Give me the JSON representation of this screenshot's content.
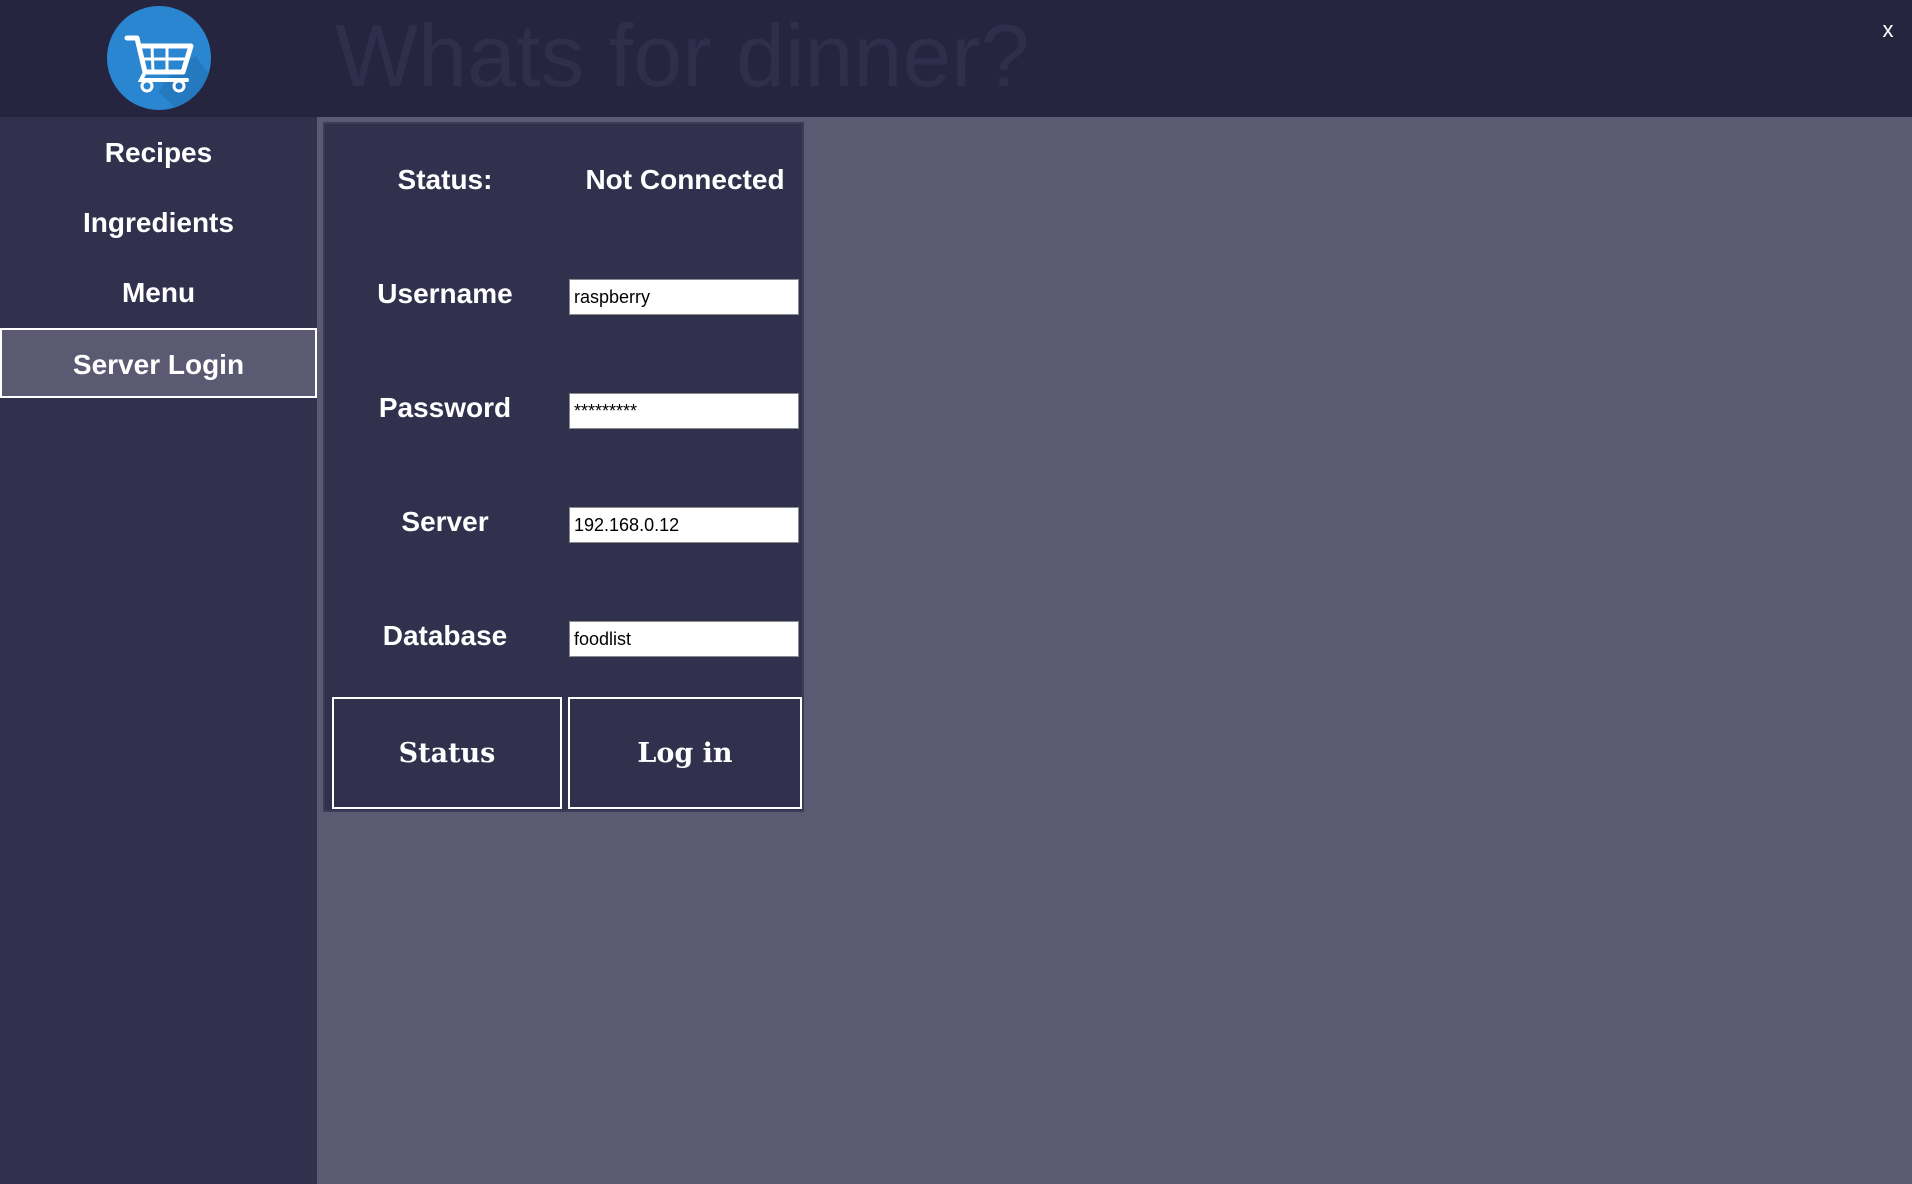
{
  "header": {
    "title": "Whats for dinner?",
    "logo_icon": "shopping-cart-icon",
    "close_label": "x"
  },
  "sidebar": {
    "items": [
      {
        "label": "Recipes",
        "active": false
      },
      {
        "label": "Ingredients",
        "active": false
      },
      {
        "label": "Menu",
        "active": false
      },
      {
        "label": "Server Login",
        "active": true
      }
    ]
  },
  "login": {
    "status_label": "Status:",
    "status_value": "Not Connected",
    "username_label": "Username",
    "username_value": "raspberry",
    "password_label": "Password",
    "password_value": "*********",
    "server_label": "Server",
    "server_value": "192.168.0.12",
    "database_label": "Database",
    "database_value": "foodlist",
    "status_button": "Status",
    "login_button": "Log in"
  },
  "colors": {
    "header_bg": "#252540",
    "sidebar_bg": "#31304d",
    "content_bg": "#5b5a72",
    "logo_accent": "#2a86d0"
  }
}
